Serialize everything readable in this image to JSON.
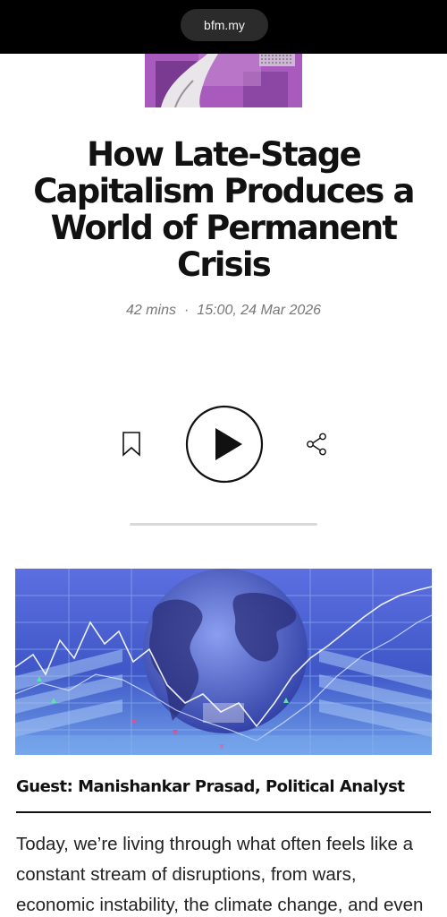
{
  "browser": {
    "url": "bfm.my"
  },
  "hero_image": {
    "description_icon": "podcast-cover-image"
  },
  "episode": {
    "title": "How Late-Stage Capitalism Produces a World of Permanent Crisis",
    "duration": "42 mins",
    "separator": "·",
    "datetime": "15:00, 24 Mar 2026",
    "progress": 0
  },
  "controls": {
    "bookmark_icon": "bookmark-icon",
    "play_icon": "play-icon",
    "share_icon": "share-icon"
  },
  "article": {
    "image_icon": "stock-market-globe-image",
    "guest_line": "Guest: Manishankar Prasad, Political Analyst",
    "paragraph": "Today, we’re living through what often feels like a constant stream of disruptions, from wars, economic instability, the climate change, and even"
  },
  "colors": {
    "topbar": "#000000",
    "url_pill": "#2b2b2b",
    "title_text": "#111111",
    "meta_text": "#777777",
    "image_blue": "#3b53c6"
  }
}
